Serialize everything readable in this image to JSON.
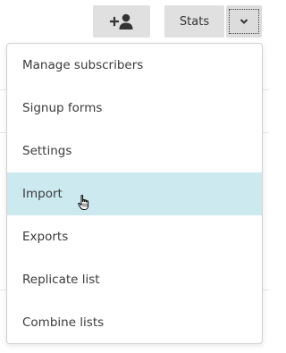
{
  "toolbar": {
    "add_subscriber_icon": "add-person-icon",
    "stats_label": "Stats",
    "dropdown_icon": "chevron-down-icon"
  },
  "menu": {
    "items": [
      {
        "label": "Manage subscribers",
        "state": "normal"
      },
      {
        "label": "Signup forms",
        "state": "normal"
      },
      {
        "label": "Settings",
        "state": "normal"
      },
      {
        "label": "Import",
        "state": "hover"
      },
      {
        "label": "Exports",
        "state": "normal"
      },
      {
        "label": "Replicate list",
        "state": "normal"
      },
      {
        "label": "Combine lists",
        "state": "normal"
      }
    ],
    "hover_color": "#cce9f0"
  },
  "cursor": "hand-pointer-icon"
}
